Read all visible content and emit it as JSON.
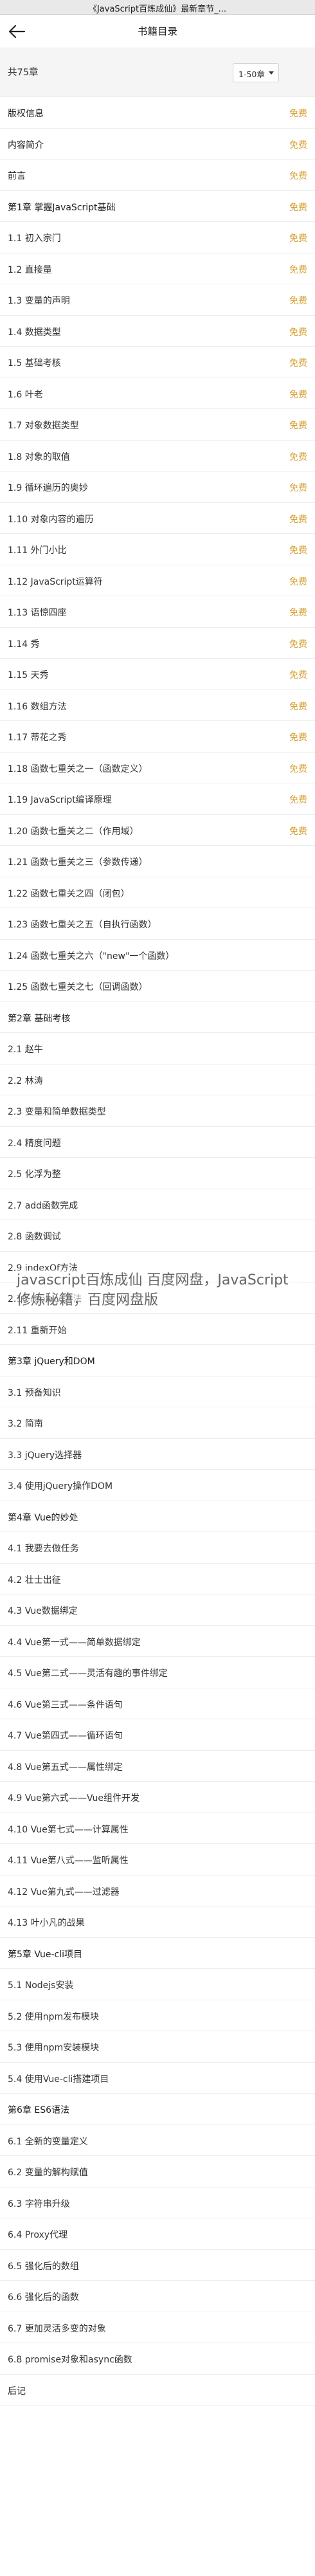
{
  "browser": {
    "title": "《JavaScript百炼成仙》最新章节_..."
  },
  "nav": {
    "title": "书籍目录"
  },
  "count": {
    "text": "共75章"
  },
  "range": {
    "selected": "1-50章"
  },
  "free_label": "免费",
  "watermark": "javascript百炼成仙 百度网盘，JavaScript修炼秘籍，百度网盘版",
  "chapters": [
    {
      "title": "版权信息",
      "free": true
    },
    {
      "title": "内容简介",
      "free": true
    },
    {
      "title": "前言",
      "free": true
    },
    {
      "title": "第1章 掌握JavaScript基础",
      "free": true
    },
    {
      "title": "1.1 初入宗门",
      "free": true
    },
    {
      "title": "1.2 直接量",
      "free": true
    },
    {
      "title": "1.3 变量的声明",
      "free": true
    },
    {
      "title": "1.4 数据类型",
      "free": true
    },
    {
      "title": "1.5 基础考核",
      "free": true
    },
    {
      "title": "1.6 叶老",
      "free": true
    },
    {
      "title": "1.7 对象数据类型",
      "free": true
    },
    {
      "title": "1.8 对象的取值",
      "free": true
    },
    {
      "title": "1.9 循环遍历的奥妙",
      "free": true
    },
    {
      "title": "1.10 对象内容的遍历",
      "free": true
    },
    {
      "title": "1.11 外门小比",
      "free": true
    },
    {
      "title": "1.12 JavaScript运算符",
      "free": true
    },
    {
      "title": "1.13 语惊四座",
      "free": true
    },
    {
      "title": "1.14 秀",
      "free": true
    },
    {
      "title": "1.15 天秀",
      "free": true
    },
    {
      "title": "1.16 数组方法",
      "free": true
    },
    {
      "title": "1.17 蒂花之秀",
      "free": true
    },
    {
      "title": "1.18 函数七重关之一（函数定义）",
      "free": true
    },
    {
      "title": "1.19 JavaScript编译原理",
      "free": true
    },
    {
      "title": "1.20 函数七重关之二（作用域）",
      "free": true
    },
    {
      "title": "1.21 函数七重关之三（参数传递）",
      "free": false
    },
    {
      "title": "1.22 函数七重关之四（闭包）",
      "free": false
    },
    {
      "title": "1.23 函数七重关之五（自执行函数）",
      "free": false
    },
    {
      "title": "1.24 函数七重关之六（\"new\"一个函数）",
      "free": false
    },
    {
      "title": "1.25 函数七重关之七（回调函数）",
      "free": false
    },
    {
      "title": "第2章 基础考核",
      "free": false
    },
    {
      "title": "2.1 赵牛",
      "free": false
    },
    {
      "title": "2.2 林涛",
      "free": false
    },
    {
      "title": "2.3 变量和简单数据类型",
      "free": false
    },
    {
      "title": "2.4 精度问题",
      "free": false
    },
    {
      "title": "2.5 化浮为整",
      "free": false
    },
    {
      "title": "2.7 add函数完成",
      "free": false
    },
    {
      "title": "2.8 函数调试",
      "free": false
    },
    {
      "title": "2.9 indexOf方法",
      "free": false
    },
    {
      "title": "2.10 replace方法",
      "free": false
    },
    {
      "title": "2.11 重新开始",
      "free": false
    },
    {
      "title": "第3章 jQuery和DOM",
      "free": false
    },
    {
      "title": "3.1 预备知识",
      "free": false
    },
    {
      "title": "3.2 简南",
      "free": false
    },
    {
      "title": "3.3 jQuery选择器",
      "free": false
    },
    {
      "title": "3.4 使用jQuery操作DOM",
      "free": false
    },
    {
      "title": "第4章 Vue的妙处",
      "free": false
    },
    {
      "title": "4.1 我要去做任务",
      "free": false
    },
    {
      "title": "4.2 壮士出征",
      "free": false
    },
    {
      "title": "4.3 Vue数据绑定",
      "free": false
    },
    {
      "title": "4.4 Vue第一式——简单数据绑定",
      "free": false
    },
    {
      "title": "4.5 Vue第二式——灵活有趣的事件绑定",
      "free": false
    },
    {
      "title": "4.6 Vue第三式——条件语句",
      "free": false
    },
    {
      "title": "4.7 Vue第四式——循环语句",
      "free": false
    },
    {
      "title": "4.8 Vue第五式——属性绑定",
      "free": false
    },
    {
      "title": "4.9 Vue第六式——Vue组件开发",
      "free": false
    },
    {
      "title": "4.10 Vue第七式——计算属性",
      "free": false
    },
    {
      "title": "4.11 Vue第八式——监听属性",
      "free": false
    },
    {
      "title": "4.12 Vue第九式——过滤器",
      "free": false
    },
    {
      "title": "4.13 叶小凡的战果",
      "free": false
    },
    {
      "title": "第5章 Vue-cli项目",
      "free": false
    },
    {
      "title": "5.1 Nodejs安装",
      "free": false
    },
    {
      "title": "5.2 使用npm发布模块",
      "free": false
    },
    {
      "title": "5.3 使用npm安装模块",
      "free": false
    },
    {
      "title": "5.4 使用Vue-cli搭建项目",
      "free": false
    },
    {
      "title": "第6章 ES6语法",
      "free": false
    },
    {
      "title": "6.1 全新的变量定义",
      "free": false
    },
    {
      "title": "6.2 变量的解构赋值",
      "free": false
    },
    {
      "title": "6.3 字符串升级",
      "free": false
    },
    {
      "title": "6.4 Proxy代理",
      "free": false
    },
    {
      "title": "6.5 强化后的数组",
      "free": false
    },
    {
      "title": "6.6 强化后的函数",
      "free": false
    },
    {
      "title": "6.7 更加灵活多变的对象",
      "free": false
    },
    {
      "title": "6.8 promise对象和async函数",
      "free": false
    },
    {
      "title": "后记",
      "free": false
    }
  ]
}
